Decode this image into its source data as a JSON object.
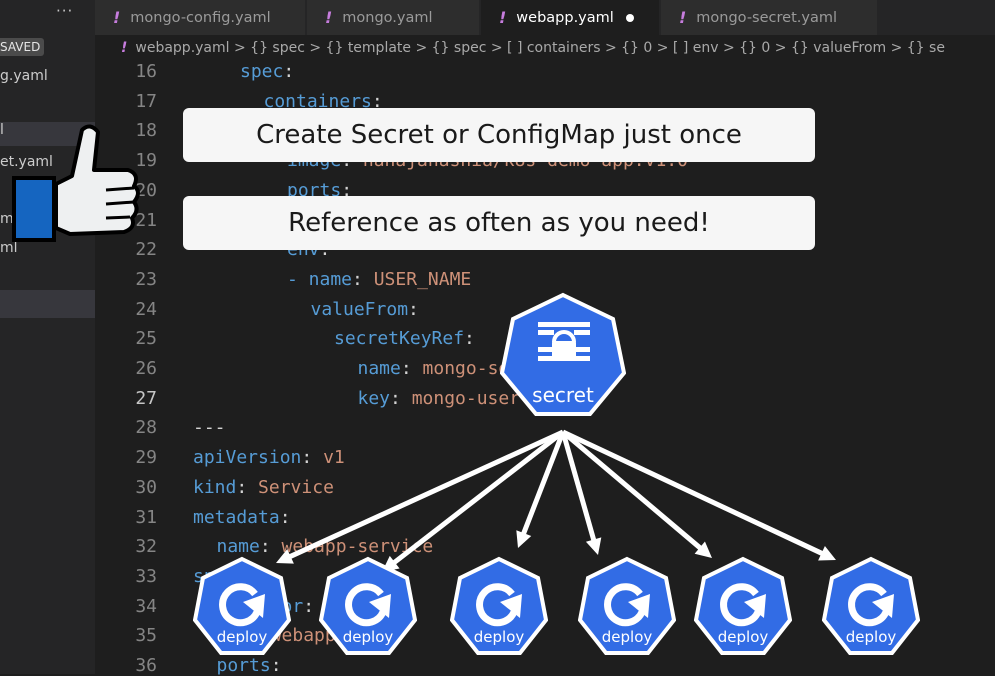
{
  "sidebar": {
    "dots": "···",
    "unsaved": "SAVED",
    "items": [
      {
        "label": "g.yaml"
      },
      {
        "label": "l"
      },
      {
        "label": "et.yaml"
      },
      {
        "label": "ml"
      },
      {
        "label": "ml"
      }
    ]
  },
  "tabs": [
    {
      "label": "mongo-config.yaml",
      "active": false
    },
    {
      "label": "mongo.yaml",
      "active": false
    },
    {
      "label": "webapp.yaml",
      "active": true,
      "modified": true
    },
    {
      "label": "mongo-secret.yaml",
      "active": false
    }
  ],
  "breadcrumb": "webapp.yaml > {} spec > {} template > {} spec > [ ] containers > {} 0 > [ ] env > {} 0 > {} valueFrom > {} se",
  "editor": {
    "line_numbers": [
      "16",
      "17",
      "18",
      "19",
      "20",
      "21",
      "22",
      "23",
      "24",
      "25",
      "26",
      "27",
      "28",
      "29",
      "30",
      "31",
      "32",
      "33",
      "34",
      "35",
      "36"
    ],
    "current_line": "27",
    "lines": [
      {
        "k": "spec",
        "p": ":",
        "v": ""
      },
      {
        "k": "containers",
        "p": ":",
        "v": ""
      },
      {
        "k": "",
        "p": "",
        "v": ""
      },
      {
        "k": "image",
        "p": ": ",
        "v": "nanajanashia/k8s-demo-app:v1.0"
      },
      {
        "k": "ports",
        "p": ":",
        "v": ""
      },
      {
        "k": "",
        "p": "",
        "v": ""
      },
      {
        "k": "env",
        "p": ":",
        "v": ""
      },
      {
        "k": "- name",
        "p": ": ",
        "v": "USER_NAME"
      },
      {
        "k": "valueFrom",
        "p": ":",
        "v": ""
      },
      {
        "k": "secretKeyRef",
        "p": ":",
        "v": ""
      },
      {
        "k": "name",
        "p": ": ",
        "v": "mongo-secret"
      },
      {
        "k": "key",
        "p": ": ",
        "v": "mongo-user"
      },
      {
        "k": "",
        "p": "---",
        "v": ""
      },
      {
        "k": "apiVersion",
        "p": ": ",
        "v": "v1"
      },
      {
        "k": "kind",
        "p": ": ",
        "v": "Service"
      },
      {
        "k": "metadata",
        "p": ":",
        "v": ""
      },
      {
        "k": "name",
        "p": ": ",
        "v": "webapp-service"
      },
      {
        "k": "spec",
        "p": ":",
        "v": ""
      },
      {
        "k": "selector",
        "p": ":",
        "v": ""
      },
      {
        "k": "app",
        "p": ": ",
        "v": "webapp"
      },
      {
        "k": "ports",
        "p": ":",
        "v": ""
      }
    ]
  },
  "overlay": {
    "banner_top": "Create Secret or ConfigMap just once",
    "banner_bottom": "Reference as often as you need!",
    "secret_label": "secret",
    "deploy_label": "deploy",
    "k8s_blue": "#326ce5",
    "thumb_color": "#1565c0"
  }
}
